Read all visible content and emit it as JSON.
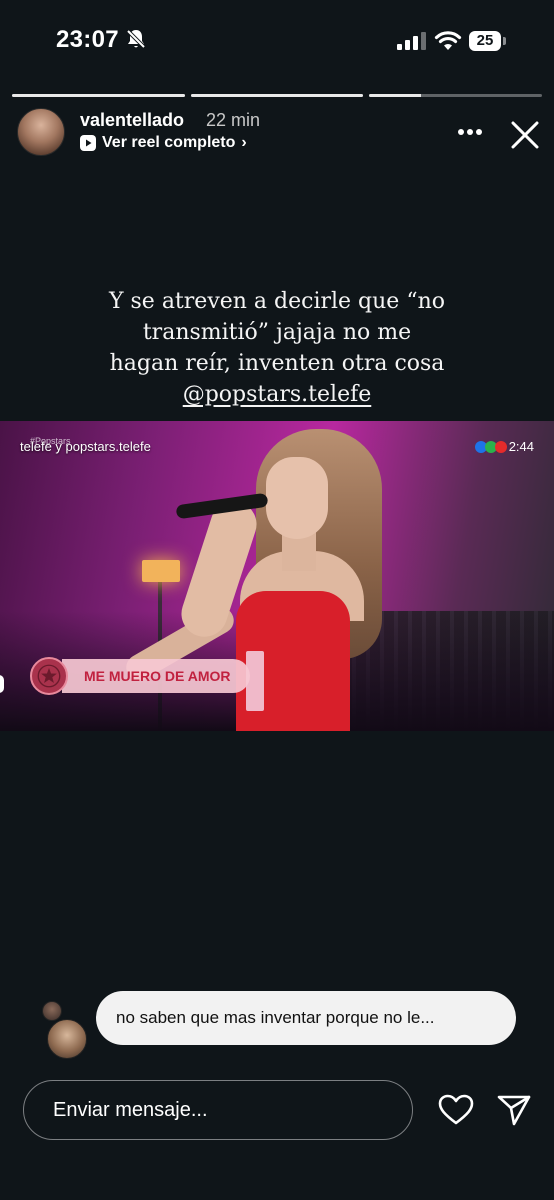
{
  "status_bar": {
    "time": "23:07",
    "battery_level": "25",
    "icons": [
      "mute-icon",
      "signal-icon",
      "wifi-icon",
      "battery-icon"
    ]
  },
  "story": {
    "progress_segments": [
      1.0,
      1.0,
      0.3
    ],
    "username": "valentellado",
    "time_ago": "22 min",
    "reel_link": "Ver reel completo",
    "reel_chevron": "›",
    "caption_lines": [
      "Y se atreven a decirle que “no",
      "transmitió” jajaja no me",
      "hagan reír, inventen otra cosa"
    ],
    "caption_mention": "@popstars.telefe"
  },
  "media": {
    "channel_small": "#Popstars",
    "channel_label": "telefe y popstars.telefe",
    "clock": "2:44",
    "banner_text": "ME MUERO DE AMOR"
  },
  "comment": {
    "text": "no saben que mas  inventar porque no le..."
  },
  "bottom_bar": {
    "message_placeholder": "Enviar mensaje..."
  },
  "colors": {
    "background": "#0f1519",
    "bubble": "#f2f2f2",
    "banner_text": "#c1213f",
    "dress": "#d81f2a"
  }
}
